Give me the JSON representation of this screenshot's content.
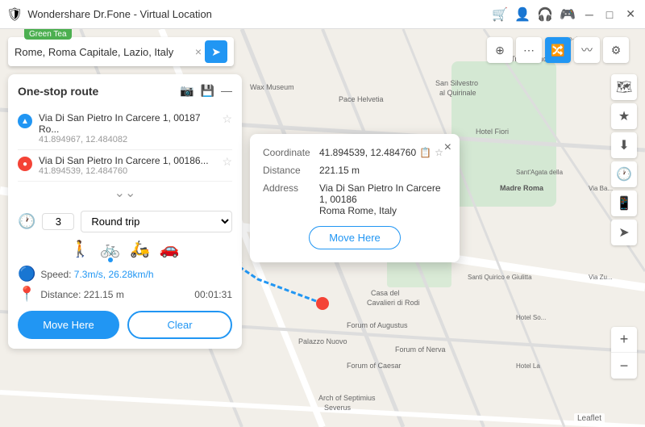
{
  "titlebar": {
    "title": "Wondershare Dr.Fone - Virtual Location",
    "icon": "🛡",
    "controls": [
      "minimize",
      "maximize",
      "close"
    ],
    "green_tea_label": "Green Tea"
  },
  "toolbar": {
    "search_placeholder": "Rome, Roma Capitale, Lazio, Italy",
    "search_value": "Rome, Roma Capitale, Lazio, Italy",
    "go_icon": "➤",
    "clear_icon": "×",
    "icons": [
      {
        "name": "teleport",
        "symbol": "⊕",
        "active": false
      },
      {
        "name": "multi-stop",
        "symbol": "⋯",
        "active": false
      },
      {
        "name": "route",
        "symbol": "🔀",
        "active": true
      },
      {
        "name": "path",
        "symbol": "〰",
        "active": false
      },
      {
        "name": "settings",
        "symbol": "⚙",
        "active": false
      }
    ]
  },
  "sidebar": {
    "title": "One-stop route",
    "header_icons": [
      "📷",
      "💾",
      "—"
    ],
    "route_items": [
      {
        "color": "blue",
        "symbol": "▲",
        "address": "Via Di San Pietro In Carcere 1, 00187 Ro...",
        "coords": "41.894967, 12.484082",
        "starred": false
      },
      {
        "color": "red",
        "symbol": "●",
        "address": "Via Di San Pietro In Carcere 1, 00186...",
        "coords": "41.894539, 12.484760",
        "starred": false
      }
    ],
    "expand_icon": "⌄⌄",
    "trip_count": "3",
    "trip_type": "Round trip",
    "transport_modes": [
      {
        "name": "walk",
        "symbol": "🚶",
        "active": false
      },
      {
        "name": "bike",
        "symbol": "🚲",
        "active": true
      },
      {
        "name": "scooter",
        "symbol": "🛵",
        "active": false
      },
      {
        "name": "car",
        "symbol": "🚗",
        "active": false
      }
    ],
    "speed_label": "Speed:",
    "speed_value": "7.3m/s, 26.28km/h",
    "distance_label": "Distance:",
    "distance_value": "221.15 m",
    "time_value": "00:01:31",
    "btn_move": "Move Here",
    "btn_clear": "Clear"
  },
  "popup": {
    "coordinate_label": "Coordinate",
    "coordinate_value": "41.894539, 12.484760",
    "distance_label": "Distance",
    "distance_value": "221.15 m",
    "address_label": "Address",
    "address_value": "Via Di San Pietro In Carcere 1, 00186\nRoma Rome, Italy",
    "btn_move": "Move Here",
    "close_icon": "×"
  },
  "right_tools": [
    {
      "name": "google-maps",
      "symbol": "🗺",
      "label": "Google Maps"
    },
    {
      "name": "favorite",
      "symbol": "★",
      "label": "Favorite"
    },
    {
      "name": "download",
      "symbol": "⬇",
      "label": "Download"
    },
    {
      "name": "history",
      "symbol": "🕐",
      "label": "History"
    },
    {
      "name": "device",
      "symbol": "📱",
      "label": "Device"
    },
    {
      "name": "location",
      "symbol": "➤",
      "label": "Location"
    }
  ],
  "zoom": {
    "plus_label": "+",
    "minus_label": "−"
  },
  "leaflet": "Leaflet"
}
